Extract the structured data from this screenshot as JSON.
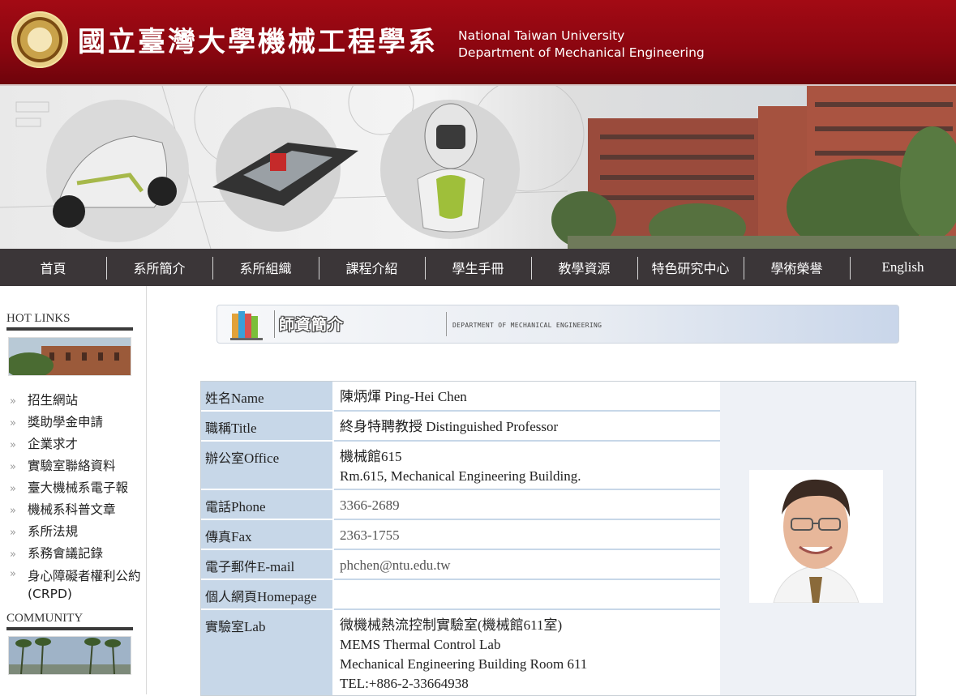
{
  "header": {
    "title_zh": "國立臺灣大學機械工程學系",
    "title_en_line1": "National Taiwan University",
    "title_en_line2": "Department of Mechanical Engineering"
  },
  "nav": [
    "首頁",
    "系所簡介",
    "系所組織",
    "課程介紹",
    "學生手冊",
    "教學資源",
    "特色研究中心",
    "學術榮譽",
    "English"
  ],
  "sidebar": {
    "hot_links_title": "HOT LINKS",
    "links": [
      "招生網站",
      "獎助學金申請",
      "企業求才",
      "實驗室聯絡資料",
      "臺大機械系電子報",
      "機械系科普文章",
      "系所法規",
      "系務會議記錄",
      "身心障礙者權利公約(CRPD)"
    ],
    "community_title": "COMMUNITY"
  },
  "section": {
    "title": "師資簡介",
    "subtitle": "DEPARTMENT OF MECHANICAL ENGINEERING"
  },
  "profile": {
    "name_label_zh": "姓名",
    "name_label_en": "Name",
    "name": "陳炳煇 Ping-Hei Chen",
    "title_label_zh": "職稱",
    "title_label_en": "Title",
    "title": "終身特聘教授 Distinguished Professor",
    "office_label_zh": "辦公室",
    "office_label_en": "Office",
    "office_line1": "機械館615",
    "office_line2": "Rm.615, Mechanical Engineering Building.",
    "phone_label_zh": "電話",
    "phone_label_en": "Phone",
    "phone": "3366-2689",
    "fax_label_zh": "傳真",
    "fax_label_en": "Fax",
    "fax": "2363-1755",
    "email_label_zh": "電子郵件",
    "email_label_en": "E-mail",
    "email": "phchen@ntu.edu.tw",
    "homepage_label_zh": "個人網頁",
    "homepage_label_en": "Homepage",
    "homepage": "",
    "lab_label_zh": "實驗室",
    "lab_label_en": "Lab",
    "lab_line1": "微機械熱流控制實驗室(機械館611室)",
    "lab_line2": "MEMS Thermal Control Lab",
    "lab_line3": "Mechanical Engineering Building Room 611",
    "lab_line4": "TEL:+886-2-33664938"
  },
  "colors": {
    "header_red": "#8a0610",
    "nav_bg": "#3b3638",
    "label_bg": "#c7d7e8"
  }
}
